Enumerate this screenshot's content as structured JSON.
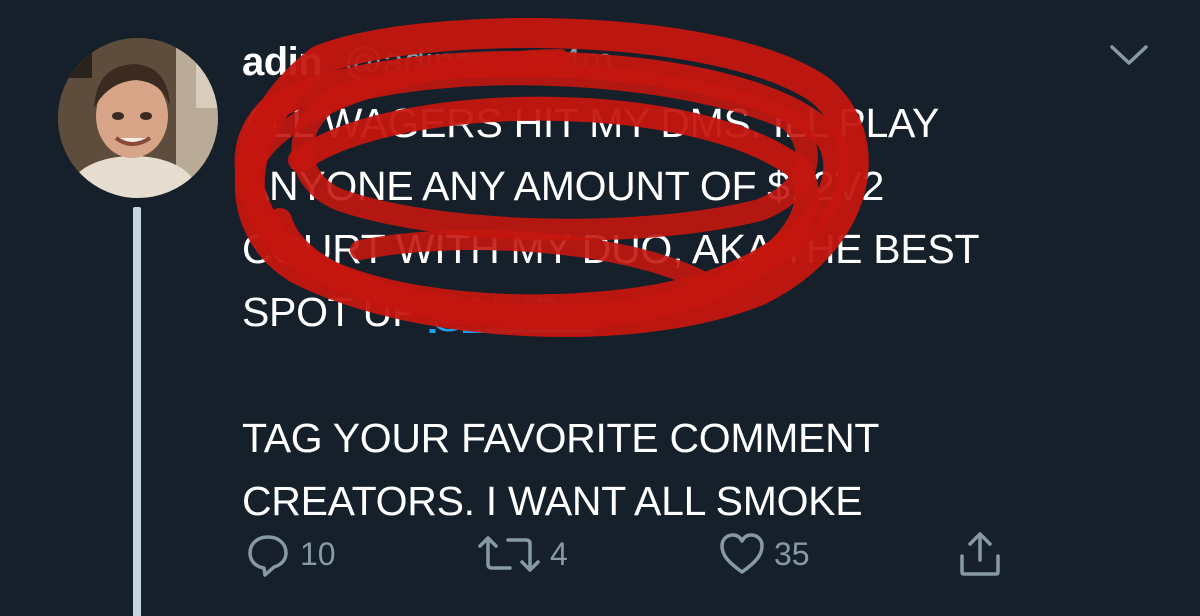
{
  "tweet": {
    "display_name": "adin",
    "handle_time": "@adinross · 4m",
    "body_lines": [
      "ALL WAGERS HIT MY DMS. ILL PLAY",
      "ANYONE ANY AMOUNT OF $. 2V2",
      "COURT WITH MY DUO, AKA THE BEST",
      "SPOT UP "
    ],
    "mention": "@NotBcr",
    "body_lines_2": [
      "TAG YOUR FAVORITE COMMENT",
      "CREATORS. I WANT ALL SMOKE"
    ]
  },
  "actions": {
    "reply_count": "10",
    "retweet_count": "4",
    "like_count": "35"
  },
  "icons": {
    "menu": "chevron-down-icon",
    "reply": "comment-icon",
    "retweet": "retweet-icon",
    "like": "heart-icon",
    "share": "share-icon"
  },
  "colors": {
    "background": "#15202b",
    "text": "#ffffff",
    "secondary": "#8899a6",
    "link": "#1da1f2",
    "scribble": "#c4160f",
    "thread_line": "#c3d6e2"
  }
}
